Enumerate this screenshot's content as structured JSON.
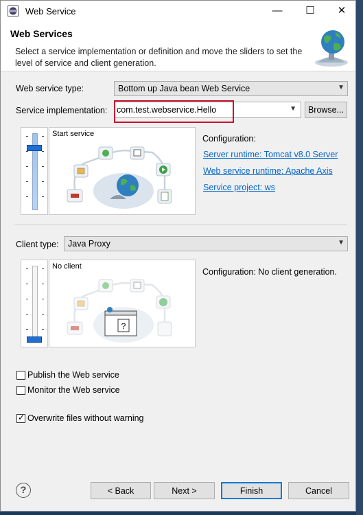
{
  "window": {
    "title": "Web Service",
    "controls": {
      "minimize": "—",
      "maximize": "☐",
      "close": "✕"
    }
  },
  "header": {
    "title": "Web Services",
    "description": "Select a service implementation or definition and move the sliders to set the level of service and client generation."
  },
  "service_type": {
    "label": "Web service type:",
    "value": "Bottom up Java bean Web Service"
  },
  "service_impl": {
    "label": "Service implementation:",
    "value": "com.test.webservice.Hello",
    "browse": "Browse..."
  },
  "service_panel": {
    "slider_label": "Start service",
    "slider_level": "Start service (top position)",
    "config_label": "Configuration:",
    "links": {
      "server": "Server runtime: Tomcat v8.0 Server",
      "runtime": "Web service runtime: Apache Axis",
      "project": "Service project: ws"
    }
  },
  "client_type": {
    "label": "Client type:",
    "value": "Java Proxy"
  },
  "client_panel": {
    "slider_label": "No client",
    "slider_level": "No client (bottom position)",
    "config_text": "Configuration: No client generation."
  },
  "options": {
    "publish": {
      "label": "Publish the Web service",
      "checked": false
    },
    "monitor": {
      "label": "Monitor the Web service",
      "checked": false
    },
    "overwrite": {
      "label": "Overwrite files without warning",
      "checked": true
    }
  },
  "buttons": {
    "help": "?",
    "back": "< Back",
    "next": "Next >",
    "finish": "Finish",
    "cancel": "Cancel"
  },
  "colors": {
    "accent": "#0078d7",
    "link": "#0066cc",
    "highlight_border": "#c8102e",
    "slider_thumb": "#1e6fd1"
  }
}
